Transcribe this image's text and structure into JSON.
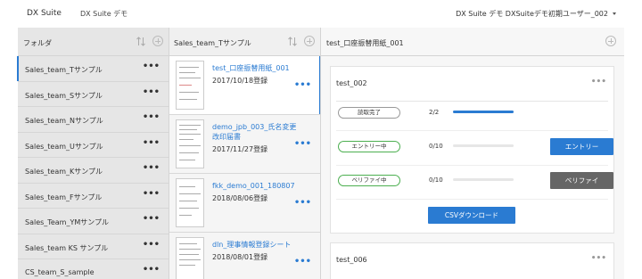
{
  "header": {
    "brand": "DX Suite",
    "tenant": "DX Suite デモ",
    "user": "DX Suite デモ DXSuiteデモ初期ユーザー_002"
  },
  "folders": {
    "title": "フォルダ",
    "items": [
      {
        "label": "Sales_team_Tサンプル"
      },
      {
        "label": "Sales_team_Sサンプル"
      },
      {
        "label": "Sales_team_Nサンプル"
      },
      {
        "label": "Sales_team_Uサンプル"
      },
      {
        "label": "Sales_team_Kサンプル"
      },
      {
        "label": "Sales_team_Fサンプル"
      },
      {
        "label": "Sales_Team_YMサンプル"
      },
      {
        "label": "Sales_team KS サンプル"
      },
      {
        "label": "CS_team_S_sample"
      }
    ]
  },
  "docs": {
    "title": "Sales_team_Tサンプル",
    "items": [
      {
        "name": "test_口座振替用紙_001",
        "date": "2017/10/18登録"
      },
      {
        "name": "demo_jpb_003_氏名変更改印届書",
        "date": "2017/11/27登録"
      },
      {
        "name": "fkk_demo_001_180807",
        "date": "2018/08/06登録"
      },
      {
        "name": "dln_理事情報登録シート",
        "date": "2018/08/01登録"
      }
    ]
  },
  "detail": {
    "title": "test_口座振替用紙_001",
    "card1": {
      "name": "test_002",
      "rows": [
        {
          "status": "読取完了",
          "count": "2/2",
          "progress": 1.0
        },
        {
          "status": "エントリー中",
          "count": "0/10",
          "progress": 0.0,
          "button": "エントリー"
        },
        {
          "status": "ベリファイ中",
          "count": "0/10",
          "progress": 0.0,
          "button": "ベリファイ"
        }
      ],
      "download": "CSVダウンロード"
    },
    "card2": {
      "name": "test_006"
    }
  },
  "colors": {
    "accent": "#2a7bd2",
    "status_green": "#4caf50",
    "button_gray": "#666666"
  }
}
